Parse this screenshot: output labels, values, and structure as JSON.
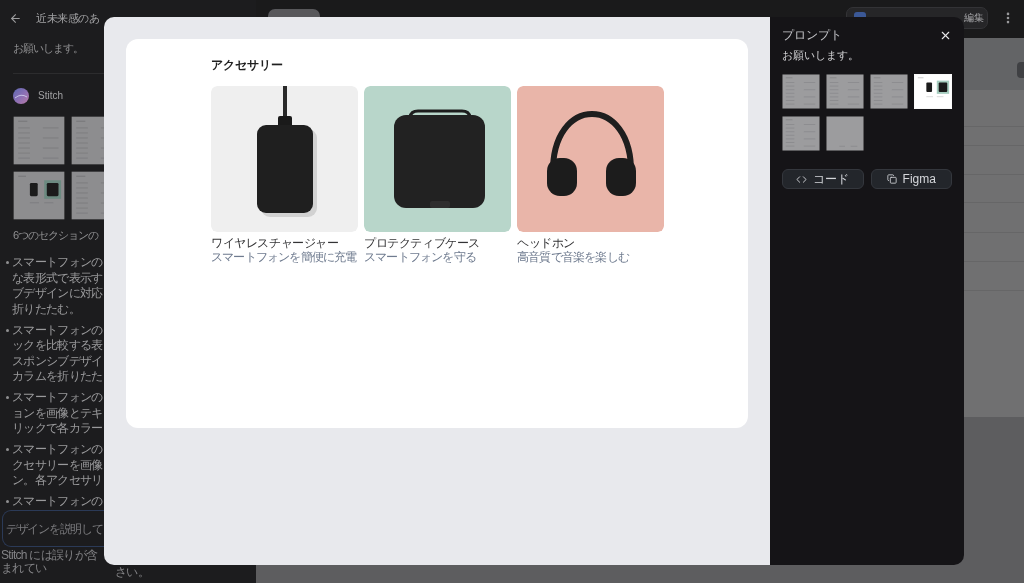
{
  "sidebar": {
    "title": "近未来感のあ",
    "prompt": "お願いします。",
    "assistant": "Stitch",
    "thumbnails": [
      {
        "kind": "document"
      },
      {
        "kind": "document"
      },
      {
        "kind": "products"
      },
      {
        "kind": "document"
      }
    ],
    "summary": "6つのセクションの",
    "bullets": [
      {
        "lines": [
          "スマートフォンの",
          "な表形式で表示す",
          "ブデザインに対応",
          "折りたたむ。"
        ]
      },
      {
        "lines": [
          "スマートフォンの",
          "ックを比較する表",
          "スポンシブデザイ",
          "カラムを折りたた"
        ]
      },
      {
        "lines": [
          "スマートフォンの",
          "ョンを画像とテキ",
          "リックで各カラー"
        ]
      },
      {
        "lines": [
          "スマートフォンの",
          "クセサリーを画像",
          "ン。各アクセサリ"
        ]
      },
      {
        "lines": [
          "スマートフォンの"
        ]
      }
    ],
    "input": {
      "placeholder": "デザインを説明して"
    },
    "disclaimer": [
      "Stitch には誤りが含まれてい",
      "さい。"
    ]
  },
  "top_bar": {
    "theme_button": {
      "label": "編集"
    }
  },
  "modal": {
    "preview": {
      "title": "アクセサリー",
      "products": [
        {
          "kind": "charger",
          "name": "ワイヤレスチャージャー",
          "description": "スマートフォンを簡便に充電"
        },
        {
          "kind": "case",
          "name": "プロテクティブケース",
          "description": "スマートフォンを守る"
        },
        {
          "kind": "headphones",
          "name": "ヘッドホン",
          "description": "高音質で音楽を楽しむ"
        }
      ]
    },
    "panel": {
      "title": "プロンプト",
      "prompt": "お願いします。",
      "screens": [
        {
          "kind": "document",
          "selected": false
        },
        {
          "kind": "document",
          "selected": false
        },
        {
          "kind": "document",
          "selected": false
        },
        {
          "kind": "products",
          "selected": true
        },
        {
          "kind": "document",
          "selected": false
        },
        {
          "kind": "blank",
          "selected": false
        }
      ],
      "buttons": [
        {
          "kind": "code",
          "label": "コード"
        },
        {
          "kind": "figma",
          "label": "Figma"
        }
      ]
    }
  }
}
